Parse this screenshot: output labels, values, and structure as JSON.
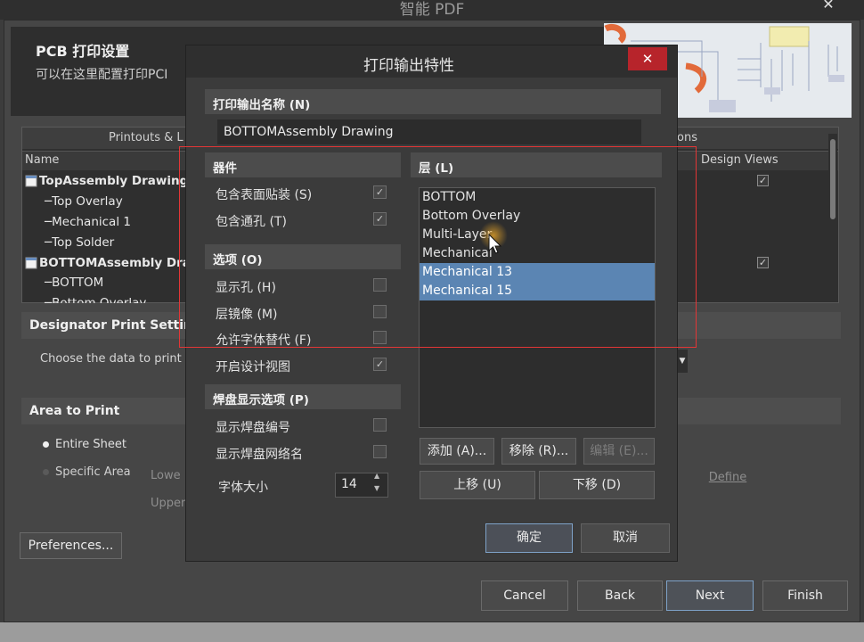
{
  "outer": {
    "title": "智能 PDF",
    "close_glyph": "✕",
    "header": {
      "title": "PCB 打印设置",
      "subtitle": "可以在这里配置打印PCI"
    },
    "table": {
      "tab_printouts": "Printouts & L",
      "tab_options": "ons",
      "col_name": "Name",
      "col_design_views": "Design Views",
      "items": [
        {
          "label": "TopAssembly Drawing",
          "bold": true
        },
        {
          "label": "─Top Overlay"
        },
        {
          "label": "─Mechanical 1"
        },
        {
          "label": "─Top Solder"
        },
        {
          "label": "BOTTOMAssembly Draw",
          "bold": true
        },
        {
          "label": "─BOTTOM"
        },
        {
          "label": "─Bottom Overlay"
        }
      ],
      "checks": [
        "✓",
        "✓"
      ]
    },
    "designator_section": "Designator Print Settings",
    "choose_data": "Choose the data to print i",
    "area_section": "Area to Print",
    "radio_entire": "Entire Sheet",
    "radio_specific": "Specific Area",
    "lower_label": "Lowe",
    "upper_label": "Upper",
    "define_label": "Define",
    "preferences_label": "Preferences...",
    "cancel_label": "Cancel",
    "back_label": "Back",
    "next_label": "Next",
    "finish_label": "Finish"
  },
  "modal": {
    "title": "打印输出特性",
    "close_glyph": "✕",
    "name_section": "打印输出名称 (N)",
    "name_value": "BOTTOMAssembly Drawing",
    "components_section": "器件",
    "include_smd": "包含表面贴装 (S)",
    "include_th": "包含通孔 (T)",
    "options_section": "选项 (O)",
    "show_holes": "显示孔 (H)",
    "mirror_layers": "层镜像 (M)",
    "font_sub": "允许字体替代 (F)",
    "design_views": "开启设计视图",
    "pad_section": "焊盘显示选项 (P)",
    "show_pad_numbers": "显示焊盘编号",
    "show_pad_nets": "显示焊盘网络名",
    "font_size_label": "字体大小",
    "font_size_value": "14",
    "checked_glyph": "✓",
    "layers_section": "层 (L)",
    "layers": [
      "BOTTOM",
      "Bottom Overlay",
      "Multi-Layer",
      "Mechanical",
      "Mechanical 13",
      "Mechanical 15"
    ],
    "add_label": "添加 (A)...",
    "remove_label": "移除 (R)...",
    "edit_label": "编辑 (E)...",
    "move_up_label": "上移 (U)",
    "move_down_label": "下移 (D)",
    "ok_label": "确定",
    "cancel_label": "取消"
  }
}
